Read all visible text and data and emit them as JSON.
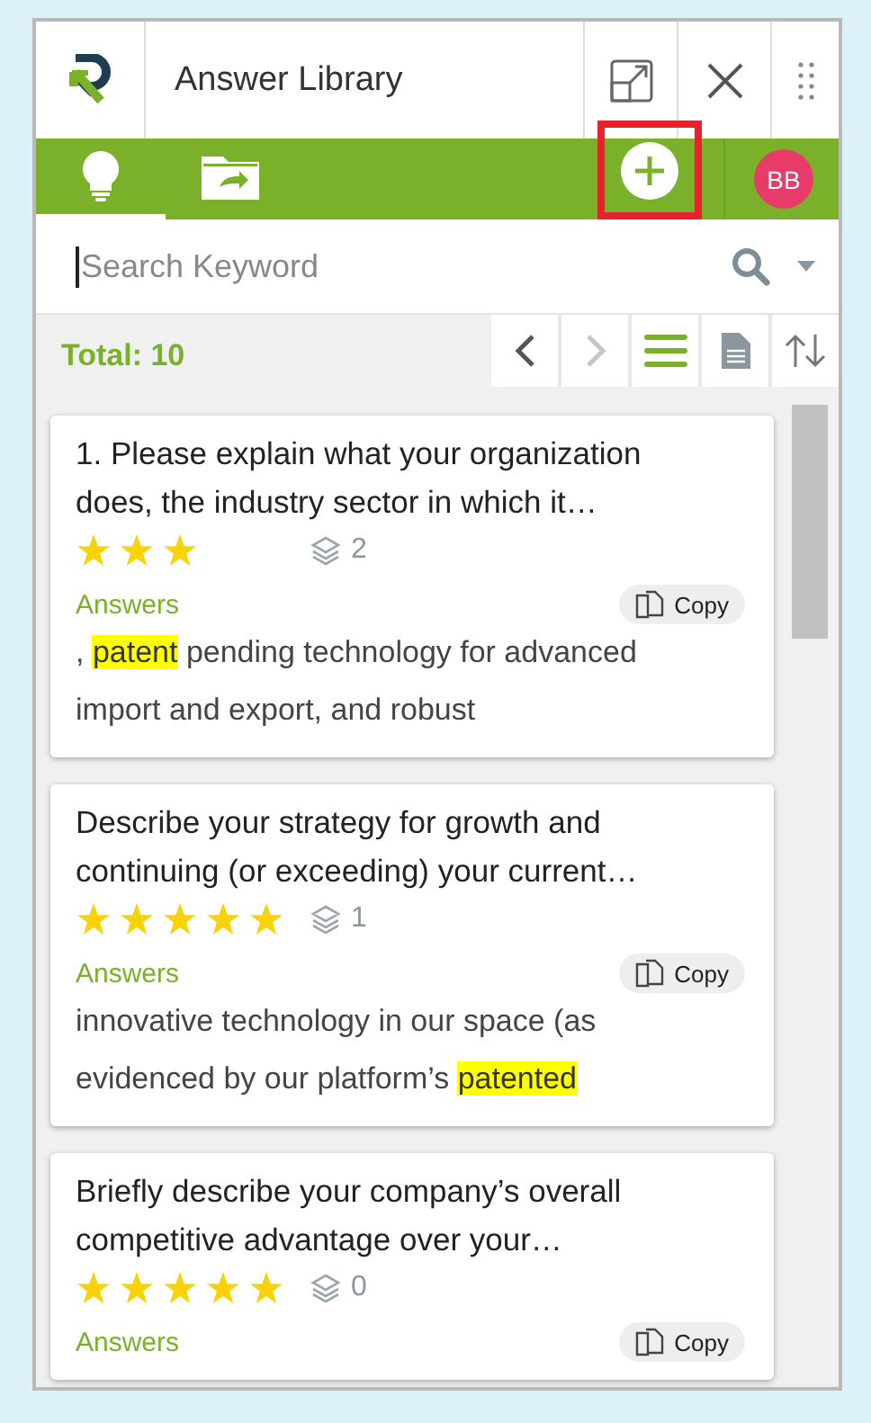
{
  "header": {
    "title": "Answer Library",
    "avatar": "BB"
  },
  "tabs": [
    {
      "kind": "bulb",
      "selected": true
    },
    {
      "kind": "folder",
      "selected": false
    }
  ],
  "search": {
    "placeholder": "Search Keyword"
  },
  "total": "Total: 10",
  "view_buttons": [
    {
      "kind": "prev",
      "disabled": false
    },
    {
      "kind": "next",
      "disabled": true
    },
    {
      "kind": "list",
      "selected": true
    },
    {
      "kind": "doc",
      "selected": false
    },
    {
      "kind": "sort",
      "selected": false
    }
  ],
  "cards": [
    {
      "title": "1. Please explain what your organization does, the industry sector in which it…",
      "stars": 3,
      "versions": "2",
      "section": "Answers",
      "copy": "Copy",
      "snippet": [
        {
          "text": ", ",
          "highlight": false
        },
        {
          "text": "patent",
          "highlight": true
        },
        {
          "text": " pending technology for advanced import and export, and robust",
          "highlight": false
        }
      ]
    },
    {
      "title": "Describe your strategy for growth and continuing (or exceeding) your current…",
      "stars": 5,
      "versions": "1",
      "section": "Answers",
      "copy": "Copy",
      "snippet": [
        {
          "text": "innovative technology in our space (as evidenced by our platform’s ",
          "highlight": false
        },
        {
          "text": "patented",
          "highlight": true
        }
      ]
    },
    {
      "title": "Briefly describe your company’s overall competitive advantage over your…",
      "stars": 5,
      "versions": "0",
      "section": "Answers",
      "copy": "Copy"
    }
  ]
}
